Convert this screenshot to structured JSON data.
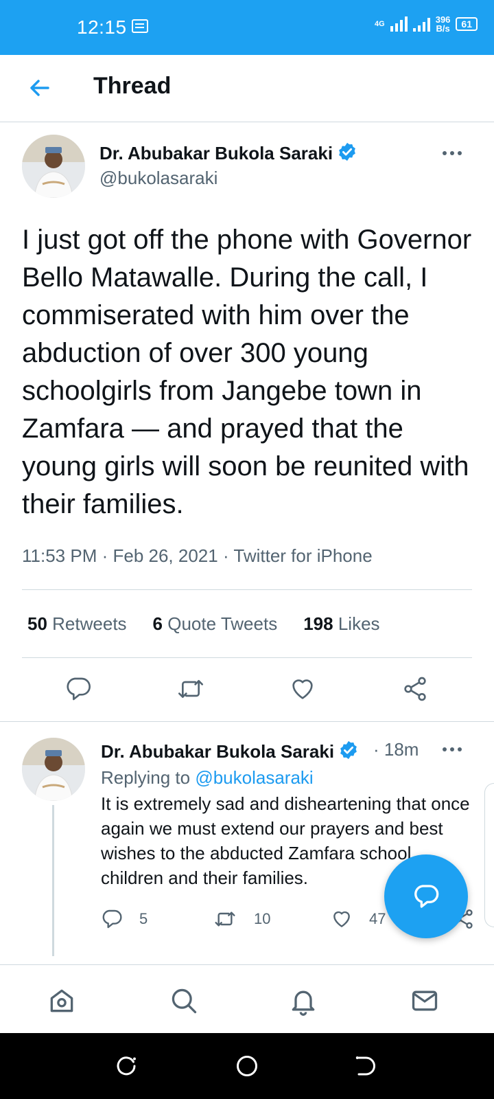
{
  "status_bar": {
    "time": "12:15",
    "network": "4G",
    "speed_value": "396",
    "speed_unit": "B/s",
    "battery": "61"
  },
  "header": {
    "title": "Thread"
  },
  "tweet": {
    "author_name": "Dr. Abubakar Bukola Saraki",
    "author_handle": "@bukolasaraki",
    "text": "I just got off the phone with Governor Bello Matawalle. During the call, I commiserated with him over the abduction of over 300 young schoolgirls from Jangebe town in Zamfara — and prayed that the young girls will soon be reunited with their families.",
    "time": "11:53 PM",
    "date": "Feb 26, 2021",
    "source": "Twitter for iPhone",
    "retweets_count": "50",
    "retweets_label": "Retweets",
    "quotes_count": "6",
    "quotes_label": "Quote Tweets",
    "likes_count": "198",
    "likes_label": "Likes"
  },
  "reply": {
    "author_name": "Dr. Abubakar Bukola Saraki",
    "time": "· 18m",
    "replying_prefix": "Replying to",
    "replying_handle": "@bukolasaraki",
    "text": "It is extremely sad and disheartening that once again we must extend our prayers and best wishes to the abducted Zamfara school children and their families.",
    "replies_count": "5",
    "retweets_count": "10",
    "likes_count": "47"
  },
  "colors": {
    "brand": "#1da1f2",
    "secondary_text": "#536471",
    "link": "#1d9bf0"
  }
}
